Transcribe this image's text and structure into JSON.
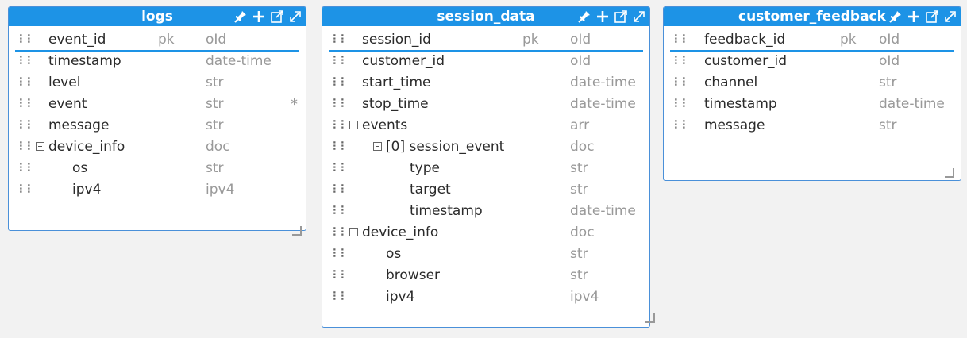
{
  "entities": [
    {
      "name": "logs",
      "fields": [
        {
          "name": "event_id",
          "pk": "pk",
          "type": "oId",
          "level": 0
        },
        {
          "name": "timestamp",
          "type": "date-time",
          "level": 0
        },
        {
          "name": "level",
          "type": "str",
          "level": 0
        },
        {
          "name": "event",
          "type": "str",
          "required": "*",
          "level": 0
        },
        {
          "name": "message",
          "type": "str",
          "level": 0
        },
        {
          "name": "device_info",
          "type": "doc",
          "level": 0,
          "collapsible": true
        },
        {
          "name": "os",
          "type": "str",
          "level": 1
        },
        {
          "name": "ipv4",
          "type": "ipv4",
          "level": 1
        }
      ]
    },
    {
      "name": "session_data",
      "fields": [
        {
          "name": "session_id",
          "pk": "pk",
          "type": "oId",
          "level": 0
        },
        {
          "name": "customer_id",
          "type": "oId",
          "level": 0
        },
        {
          "name": "start_time",
          "type": "date-time",
          "level": 0
        },
        {
          "name": "stop_time",
          "type": "date-time",
          "level": 0
        },
        {
          "name": "events",
          "type": "arr",
          "level": 0,
          "collapsible": true
        },
        {
          "name": "[0] session_event",
          "type": "doc",
          "level": 1,
          "collapsible": true
        },
        {
          "name": "type",
          "type": "str",
          "level": 2
        },
        {
          "name": "target",
          "type": "str",
          "level": 2
        },
        {
          "name": "timestamp",
          "type": "date-time",
          "level": 2
        },
        {
          "name": "device_info",
          "type": "doc",
          "level": 0,
          "collapsible": true
        },
        {
          "name": "os",
          "type": "str",
          "level": 1
        },
        {
          "name": "browser",
          "type": "str",
          "level": 1
        },
        {
          "name": "ipv4",
          "type": "ipv4",
          "level": 1
        }
      ]
    },
    {
      "name": "customer_feedback",
      "fields": [
        {
          "name": "feedback_id",
          "pk": "pk",
          "type": "oId",
          "level": 0
        },
        {
          "name": "customer_id",
          "type": "oId",
          "level": 0
        },
        {
          "name": "channel",
          "type": "str",
          "level": 0
        },
        {
          "name": "timestamp",
          "type": "date-time",
          "level": 0
        },
        {
          "name": "message",
          "type": "str",
          "level": 0
        }
      ]
    }
  ],
  "header_icons": [
    "pin-icon",
    "add-field-icon",
    "open-external-icon",
    "expand-icon"
  ],
  "colors": {
    "header": "#1d93e6",
    "border": "#4a90d9",
    "type_text": "#999999",
    "background": "#f2f2f2"
  }
}
